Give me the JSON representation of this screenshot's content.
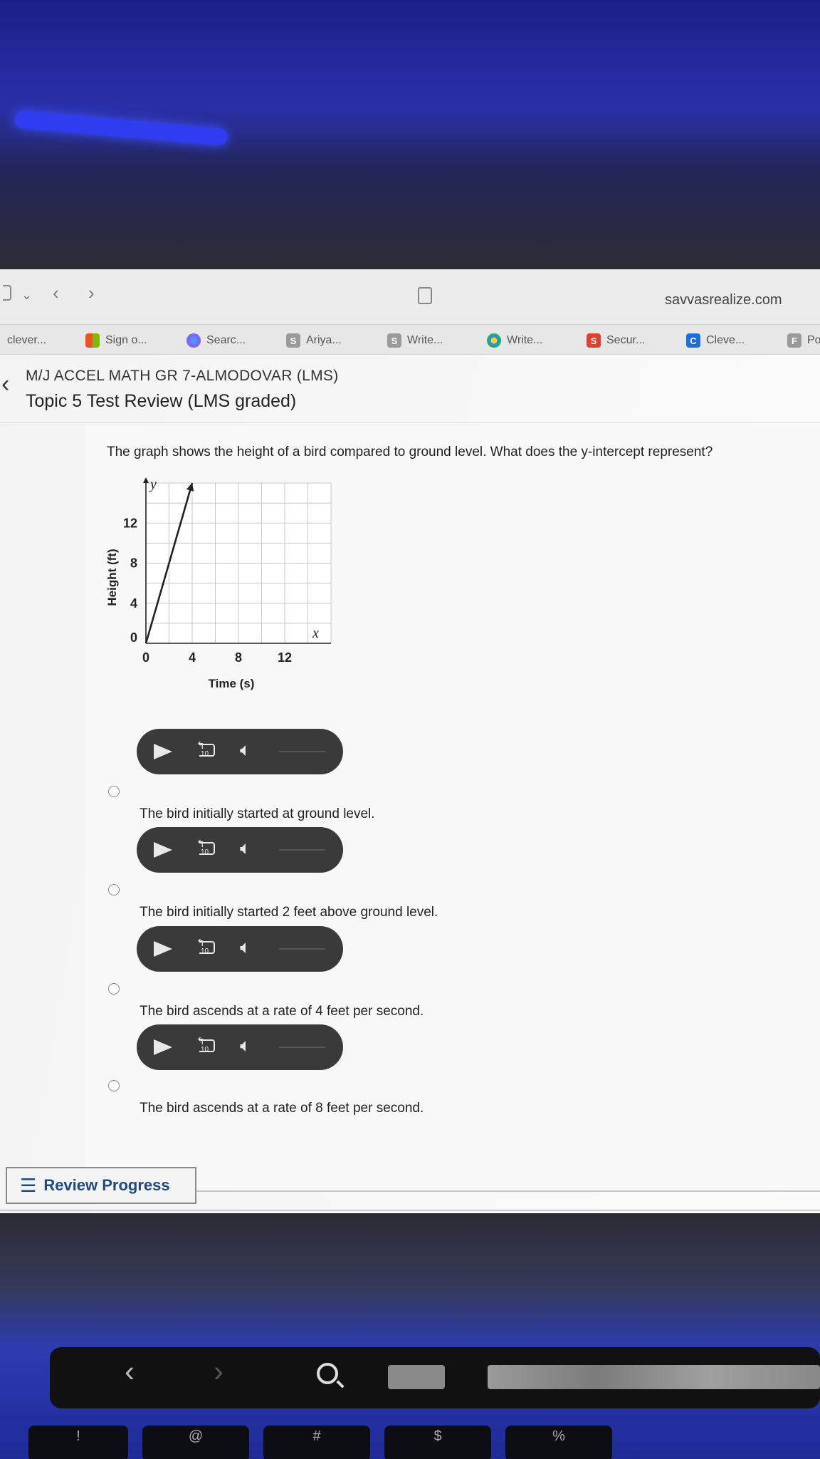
{
  "browser": {
    "url": "savvasrealize.com",
    "bookmarks": [
      {
        "label": "clever...",
        "icon": "none"
      },
      {
        "label": "Sign o...",
        "icon": "ms-grid-icon"
      },
      {
        "label": "Searc...",
        "icon": "globe-icon"
      },
      {
        "label": "Ariya...",
        "icon": "s-icon"
      },
      {
        "label": "Write...",
        "icon": "s-icon"
      },
      {
        "label": "Write...",
        "icon": "flower-icon"
      },
      {
        "label": "Secur...",
        "icon": "s-red-icon"
      },
      {
        "label": "Cleve...",
        "icon": "c-icon"
      },
      {
        "label": "Po",
        "icon": "f-icon"
      }
    ],
    "bookmark_icon_letters": {
      "s": "S",
      "c": "C",
      "f": "F"
    }
  },
  "header": {
    "course": "M/J ACCEL MATH GR 7-ALMODOVAR (LMS)",
    "title": "Topic 5 Test Review (LMS graded)"
  },
  "question": {
    "prompt": "The graph shows the height of a bird compared to ground level. What does the y-intercept represent?",
    "options": [
      "The bird initially started at ground level.",
      "The bird initially started 2 feet above ground level.",
      "The bird ascends at a rate of 4 feet per second.",
      "The bird ascends at a rate of 8 feet per second."
    ]
  },
  "audio_player": {
    "rewind_label": "10"
  },
  "review_button": {
    "label": "Review Progress"
  },
  "keyboard": {
    "keys": [
      "!",
      "@",
      "#",
      "$",
      "%"
    ]
  },
  "chart_data": {
    "type": "line",
    "xlabel": "Time (s)",
    "ylabel": "Height (ft)",
    "x_axis_name": "x",
    "y_axis_name": "y",
    "xlim": [
      0,
      16
    ],
    "ylim": [
      0,
      16
    ],
    "x_ticks": [
      0,
      4,
      8,
      12
    ],
    "y_ticks": [
      0,
      4,
      8,
      12
    ],
    "grid": true,
    "series": [
      {
        "x": [
          0,
          4
        ],
        "y": [
          0,
          16
        ]
      }
    ],
    "colors": {
      "line": "#222222",
      "grid": "#c8c8c8"
    }
  }
}
